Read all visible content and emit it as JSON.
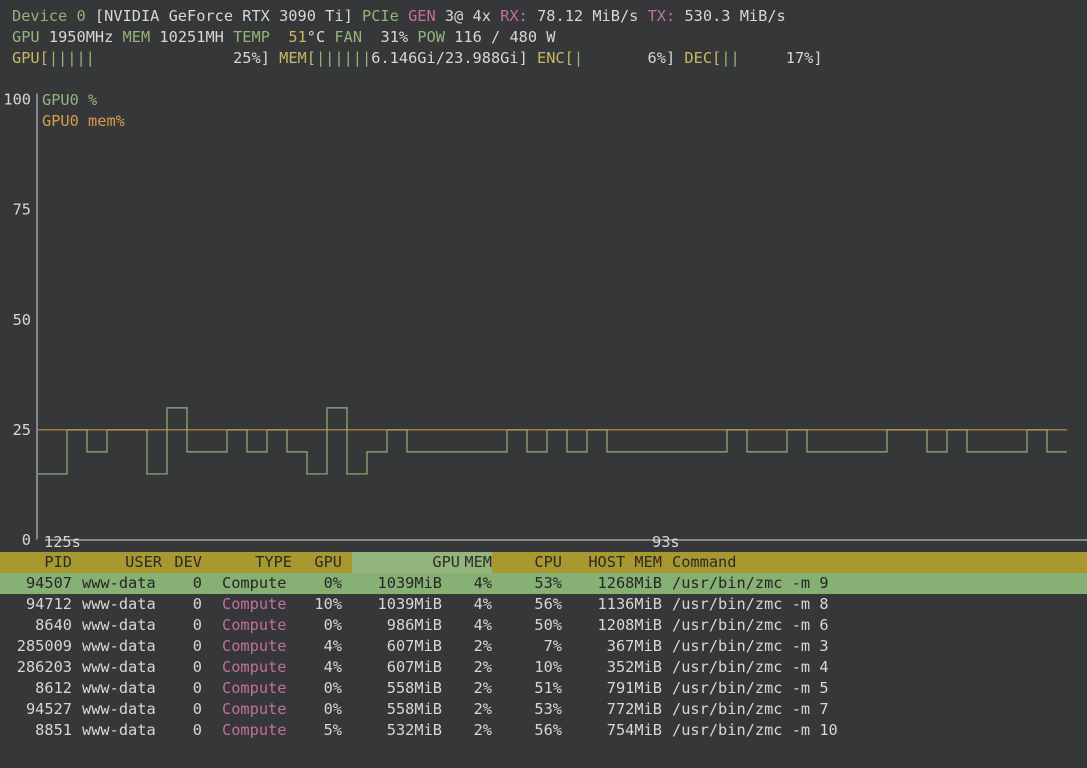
{
  "device": {
    "label": "Device 0",
    "name": "[NVIDIA GeForce RTX 3090 Ti]",
    "pcie_label": "PCIe",
    "gen_label": "GEN",
    "gen_value": "3@ 4x",
    "rx_label": "RX:",
    "rx_value": "78.12 MiB/s",
    "tx_label": "TX:",
    "tx_value": "530.3 MiB/s"
  },
  "stats": {
    "gpu_label": "GPU",
    "gpu_clock": "1950MHz",
    "mem_label": "MEM",
    "mem_clock": "10251MH",
    "temp_label": "TEMP",
    "temp_value": "51",
    "temp_unit": "°C",
    "fan_label": "FAN",
    "fan_value": "31%",
    "pow_label": "POW",
    "pow_value": "116 / 480 W"
  },
  "bars": {
    "gpu_label": "GPU[",
    "gpu_fill": "|||||",
    "gpu_value": "25%]",
    "gpu_percent": 25,
    "mem_label": "MEM[",
    "mem_fill": "||||||",
    "mem_value": "6.146Gi/23.988Gi]",
    "enc_label": "ENC[",
    "enc_fill": "|",
    "enc_value": "6%]",
    "dec_label": "DEC[",
    "dec_fill": "||",
    "dec_value": "17%]"
  },
  "colors": {
    "background": "#363738",
    "gpu_series": "#93b47a",
    "mem_series": "#d99b4b",
    "header_yellow": "#a7992f",
    "header_green": "#93b47a",
    "selected_row": "#87b075"
  },
  "chart_data": {
    "type": "line",
    "ylim": [
      0,
      100
    ],
    "yticks": [
      "0",
      "25",
      "50",
      "75",
      "100"
    ],
    "xtick_labels": [
      "125s",
      "93s"
    ],
    "legend": [
      "GPU0 %",
      "GPU0 mem%"
    ],
    "series": [
      {
        "name": "GPU0 %",
        "values": [
          15,
          25,
          20,
          25,
          25,
          15,
          30,
          20,
          20,
          25,
          20,
          25,
          20,
          15,
          30,
          15,
          20,
          25,
          20,
          20,
          20,
          20,
          20,
          25,
          20,
          25,
          20,
          25,
          20,
          20,
          20,
          20,
          20,
          20,
          25,
          20,
          20,
          25,
          20,
          20,
          20,
          20,
          25,
          25,
          20,
          25,
          20,
          20,
          20,
          25,
          20
        ]
      },
      {
        "name": "GPU0 mem%",
        "values": [
          25,
          25,
          25,
          25,
          25,
          25,
          25,
          25,
          25,
          25,
          25,
          25,
          25,
          25,
          25,
          25,
          25,
          25,
          25,
          25,
          25,
          25,
          25,
          25,
          25,
          25,
          25,
          25,
          25,
          25,
          25,
          25,
          25,
          25,
          25,
          25,
          25,
          25,
          25,
          25,
          25,
          25,
          25,
          25,
          25,
          25,
          25,
          25,
          25,
          25,
          25
        ]
      }
    ]
  },
  "table": {
    "headers": [
      "PID",
      "USER",
      "DEV",
      "TYPE",
      "GPU",
      "GPU",
      "MEM",
      "CPU",
      "HOST MEM",
      "Command"
    ],
    "rows": [
      [
        "94507",
        "www-data",
        "0",
        "Compute",
        "0%",
        "1039MiB",
        "4%",
        "53%",
        "1268MiB",
        "/usr/bin/zmc -m 9"
      ],
      [
        "94712",
        "www-data",
        "0",
        "Compute",
        "10%",
        "1039MiB",
        "4%",
        "56%",
        "1136MiB",
        "/usr/bin/zmc -m 8"
      ],
      [
        "8640",
        "www-data",
        "0",
        "Compute",
        "0%",
        "986MiB",
        "4%",
        "50%",
        "1208MiB",
        "/usr/bin/zmc -m 6"
      ],
      [
        "285009",
        "www-data",
        "0",
        "Compute",
        "4%",
        "607MiB",
        "2%",
        "7%",
        "367MiB",
        "/usr/bin/zmc -m 3"
      ],
      [
        "286203",
        "www-data",
        "0",
        "Compute",
        "4%",
        "607MiB",
        "2%",
        "10%",
        "352MiB",
        "/usr/bin/zmc -m 4"
      ],
      [
        "8612",
        "www-data",
        "0",
        "Compute",
        "0%",
        "558MiB",
        "2%",
        "51%",
        "791MiB",
        "/usr/bin/zmc -m 5"
      ],
      [
        "94527",
        "www-data",
        "0",
        "Compute",
        "0%",
        "558MiB",
        "2%",
        "53%",
        "772MiB",
        "/usr/bin/zmc -m 7"
      ],
      [
        "8851",
        "www-data",
        "0",
        "Compute",
        "5%",
        "532MiB",
        "2%",
        "56%",
        "754MiB",
        "/usr/bin/zmc -m 10"
      ]
    ]
  }
}
